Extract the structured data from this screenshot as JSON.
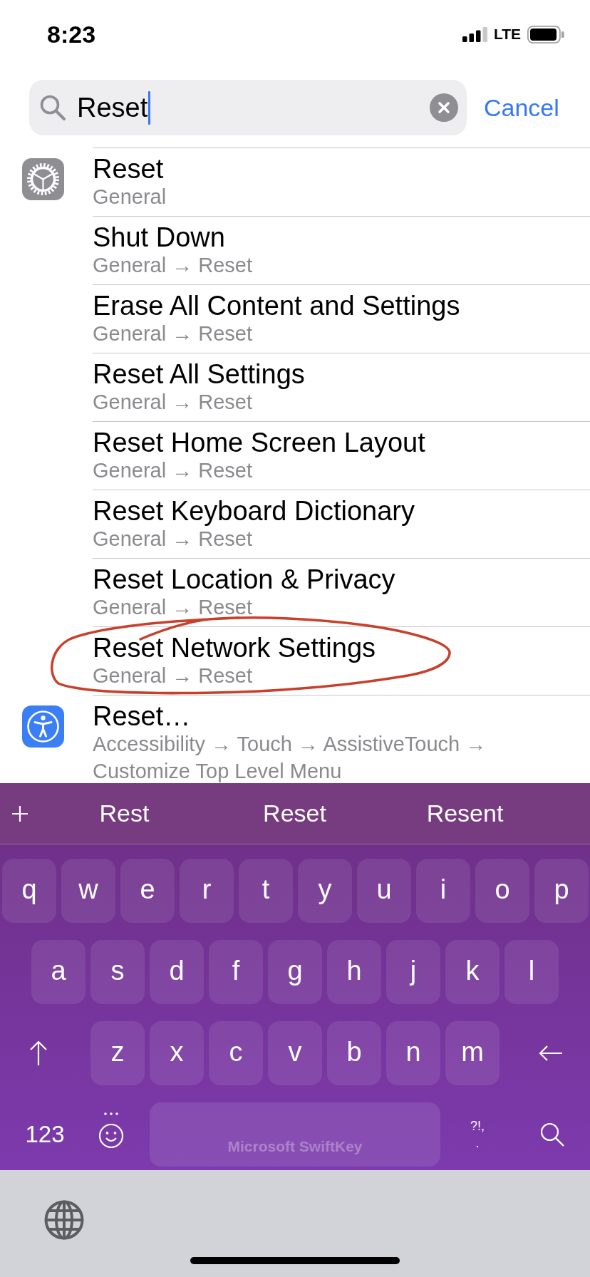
{
  "status_bar": {
    "time": "8:23",
    "network": "LTE"
  },
  "search": {
    "value": "Reset",
    "focused": true,
    "cancel": "Cancel"
  },
  "result_groups": [
    {
      "kind": "settings",
      "results": [
        {
          "title": "Reset",
          "path": "General",
          "circled": false
        },
        {
          "title": "Shut Down",
          "path": "General → Reset",
          "circled": false
        },
        {
          "title": "Erase All Content and Settings",
          "path": "General → Reset",
          "circled": false
        },
        {
          "title": "Reset All Settings",
          "path": "General → Reset",
          "circled": false
        },
        {
          "title": "Reset Home Screen Layout",
          "path": "General → Reset",
          "circled": false
        },
        {
          "title": "Reset Keyboard Dictionary",
          "path": "General → Reset",
          "circled": false
        },
        {
          "title": "Reset Location & Privacy",
          "path": "General → Reset",
          "circled": false
        },
        {
          "title": "Reset Network Settings",
          "path": "General → Reset",
          "circled": true
        }
      ]
    },
    {
      "kind": "accessibility",
      "results": [
        {
          "title": "Reset…",
          "path": "Accessibility → Touch → AssistiveTouch → Customize Top Level Menu",
          "circled": false
        }
      ]
    }
  ],
  "keyboard": {
    "suggestions": [
      "Rest",
      "Reset",
      "Resent"
    ],
    "rows": [
      [
        "q",
        "w",
        "e",
        "r",
        "t",
        "y",
        "u",
        "i",
        "o",
        "p"
      ],
      [
        "a",
        "s",
        "d",
        "f",
        "g",
        "h",
        "j",
        "k",
        "l"
      ],
      [
        "z",
        "x",
        "c",
        "v",
        "b",
        "n",
        "m"
      ]
    ],
    "numbers_key": "123",
    "punctuation_key": {
      "top": "?!,",
      "bottom": "."
    },
    "space_label": "Microsoft SwiftKey"
  }
}
